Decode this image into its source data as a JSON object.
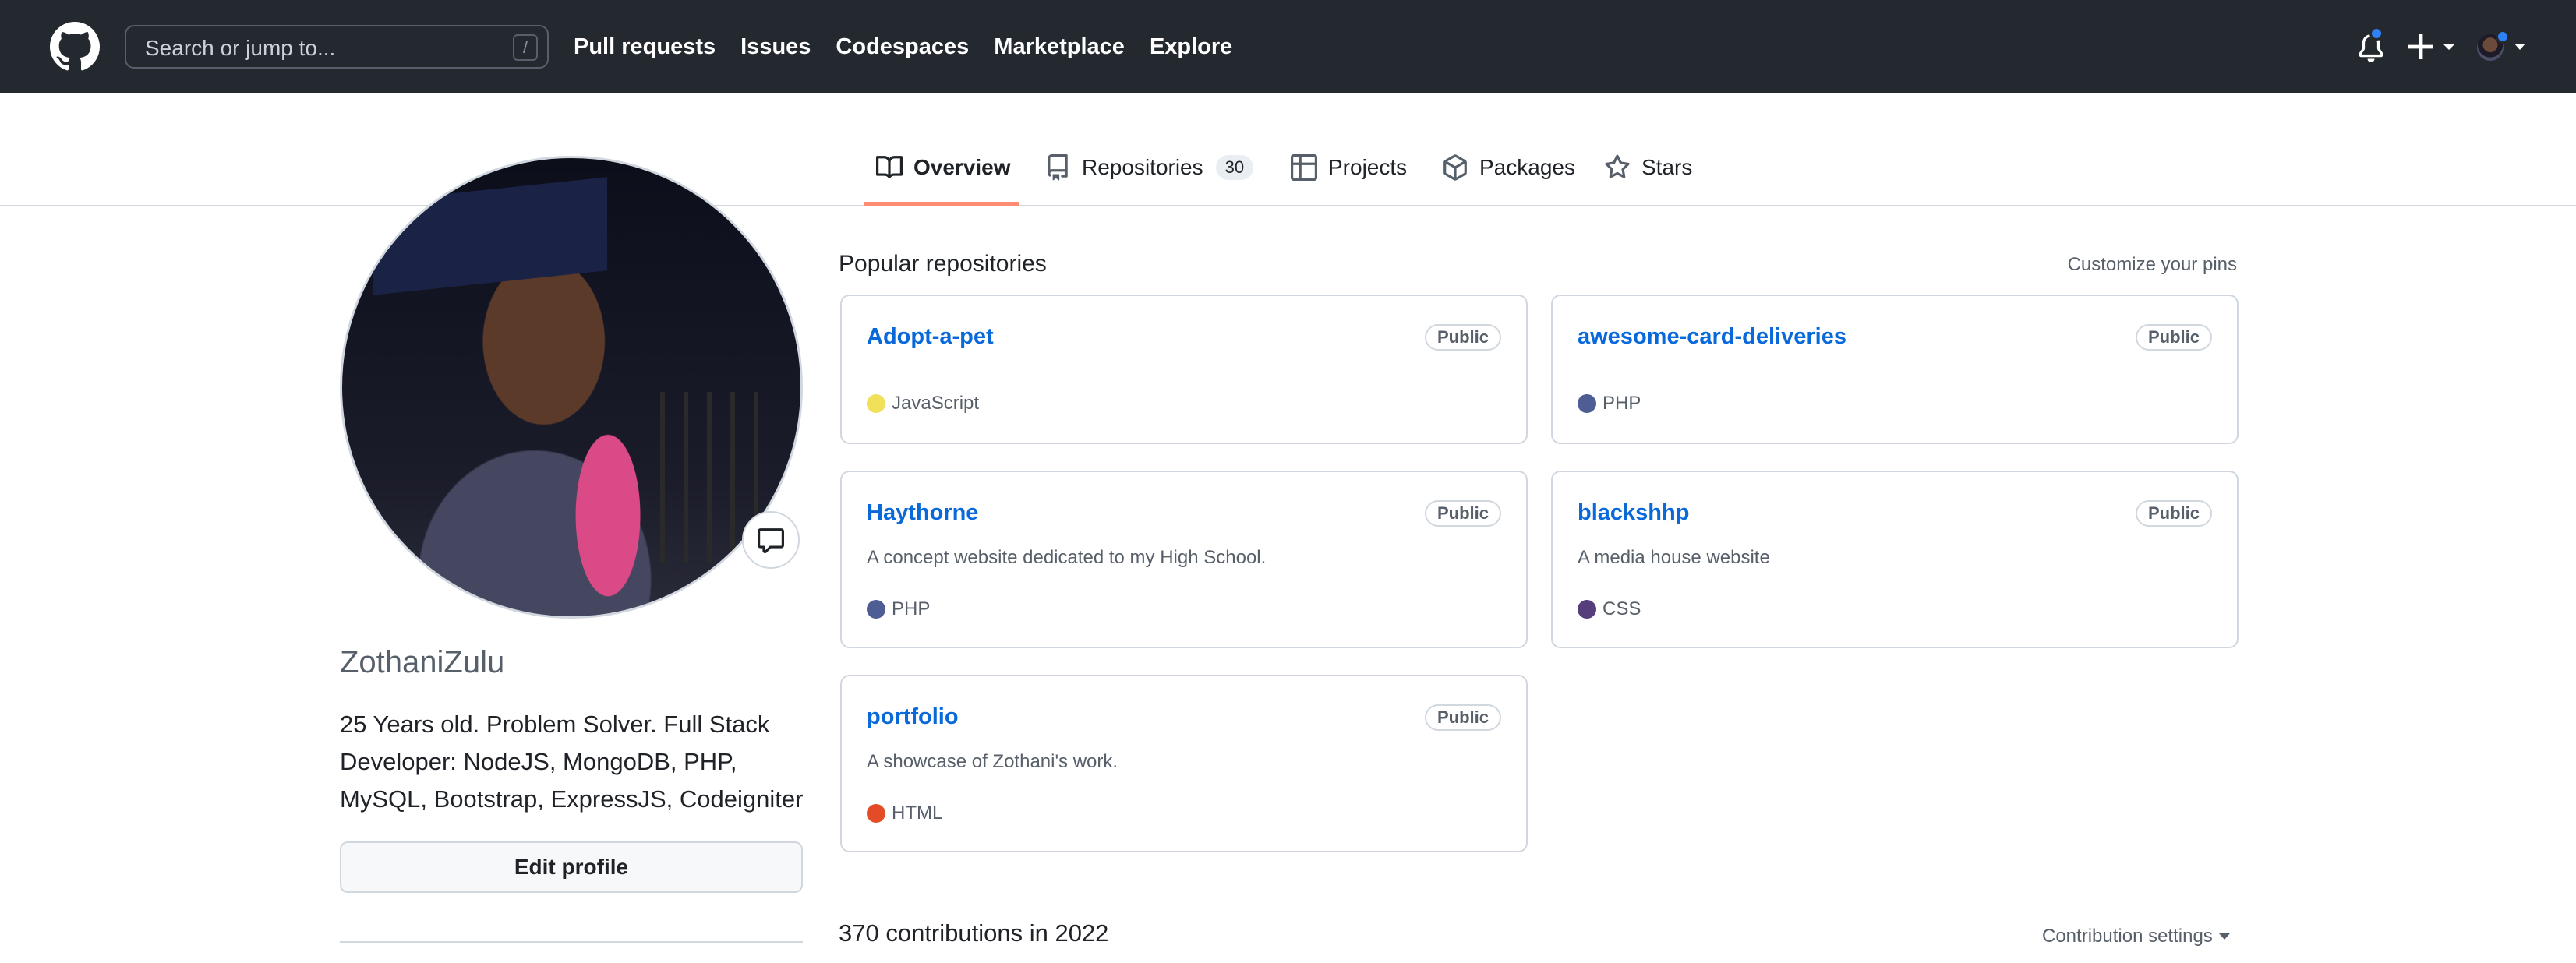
{
  "header": {
    "search_placeholder": "Search or jump to...",
    "search_shortcut": "/",
    "nav": [
      "Pull requests",
      "Issues",
      "Codespaces",
      "Marketplace",
      "Explore"
    ],
    "notification_color": "#2f81f7"
  },
  "tabs": [
    {
      "label": "Overview",
      "icon": "book-icon",
      "selected": true
    },
    {
      "label": "Repositories",
      "icon": "repo-icon",
      "count": "30"
    },
    {
      "label": "Projects",
      "icon": "table-icon"
    },
    {
      "label": "Packages",
      "icon": "package-icon"
    },
    {
      "label": "Stars",
      "icon": "star-icon"
    }
  ],
  "profile": {
    "username": "ZothaniZulu",
    "bio": "25 Years old. Problem Solver. Full Stack Developer: NodeJS, MongoDB, PHP, MySQL, Bootstrap, ExpressJS, Codeigniter",
    "edit_label": "Edit profile"
  },
  "popular": {
    "title": "Popular repositories",
    "customize": "Customize your pins",
    "repos": [
      {
        "name": "Adopt-a-pet",
        "visibility": "Public",
        "description": "",
        "language": "JavaScript",
        "lang_color": "#f1e05a"
      },
      {
        "name": "awesome-card-deliveries",
        "visibility": "Public",
        "description": "",
        "language": "PHP",
        "lang_color": "#4F5D95"
      },
      {
        "name": "Haythorne",
        "visibility": "Public",
        "description": "A concept website dedicated to my High School.",
        "language": "PHP",
        "lang_color": "#4F5D95"
      },
      {
        "name": "blackshhp",
        "visibility": "Public",
        "description": "A media house website",
        "language": "CSS",
        "lang_color": "#563d7c"
      },
      {
        "name": "portfolio",
        "visibility": "Public",
        "description": "A showcase of Zothani's work.",
        "language": "HTML",
        "lang_color": "#e34c26"
      }
    ]
  },
  "contributions": {
    "title": "370 contributions in 2022",
    "settings": "Contribution settings"
  }
}
